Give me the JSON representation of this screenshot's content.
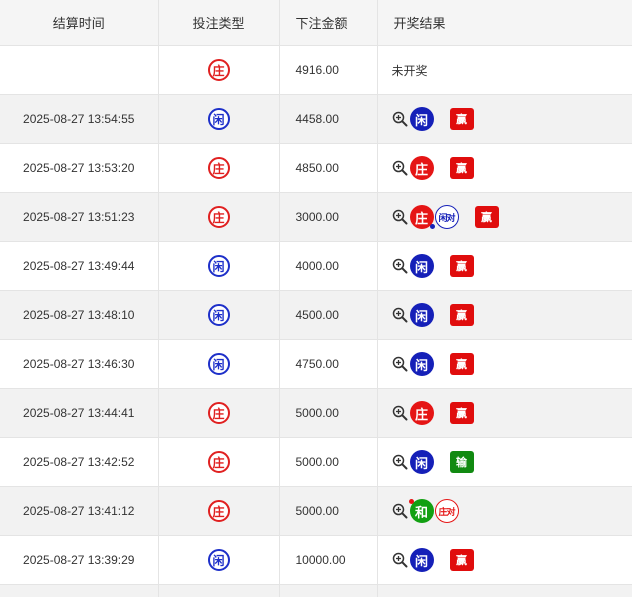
{
  "headers": {
    "settle_time": "结算时间",
    "bet_type": "投注类型",
    "bet_amount": "下注金额",
    "result": "开奖结果"
  },
  "rows": [
    {
      "time": "",
      "bet": "庄",
      "bet_side": "zhuang",
      "amount": "4916.00",
      "pending": "未开奖"
    },
    {
      "time": "2025-08-27 13:54:55",
      "bet": "闲",
      "bet_side": "xian",
      "amount": "4458.00",
      "result_ball": "闲",
      "result_side": "xian",
      "outcome": "赢",
      "outcome_kind": "win"
    },
    {
      "time": "2025-08-27 13:53:20",
      "bet": "庄",
      "bet_side": "zhuang",
      "amount": "4850.00",
      "result_ball": "庄",
      "result_side": "zhuang",
      "outcome": "赢",
      "outcome_kind": "win"
    },
    {
      "time": "2025-08-27 13:51:23",
      "bet": "庄",
      "bet_side": "zhuang",
      "amount": "3000.00",
      "result_ball": "庄",
      "result_side": "zhuang",
      "dot": "blue-br",
      "pair": "闲对",
      "pair_side": "xian",
      "outcome": "赢",
      "outcome_kind": "win"
    },
    {
      "time": "2025-08-27 13:49:44",
      "bet": "闲",
      "bet_side": "xian",
      "amount": "4000.00",
      "result_ball": "闲",
      "result_side": "xian",
      "outcome": "赢",
      "outcome_kind": "win"
    },
    {
      "time": "2025-08-27 13:48:10",
      "bet": "闲",
      "bet_side": "xian",
      "amount": "4500.00",
      "result_ball": "闲",
      "result_side": "xian",
      "outcome": "赢",
      "outcome_kind": "win"
    },
    {
      "time": "2025-08-27 13:46:30",
      "bet": "闲",
      "bet_side": "xian",
      "amount": "4750.00",
      "result_ball": "闲",
      "result_side": "xian",
      "outcome": "赢",
      "outcome_kind": "win"
    },
    {
      "time": "2025-08-27 13:44:41",
      "bet": "庄",
      "bet_side": "zhuang",
      "amount": "5000.00",
      "result_ball": "庄",
      "result_side": "zhuang",
      "outcome": "赢",
      "outcome_kind": "win"
    },
    {
      "time": "2025-08-27 13:42:52",
      "bet": "庄",
      "bet_side": "zhuang",
      "amount": "5000.00",
      "result_ball": "闲",
      "result_side": "xian",
      "outcome": "输",
      "outcome_kind": "lose"
    },
    {
      "time": "2025-08-27 13:41:12",
      "bet": "庄",
      "bet_side": "zhuang",
      "amount": "5000.00",
      "result_ball": "和",
      "result_side": "he",
      "dot": "red-tl",
      "pair": "庄对",
      "pair_side": "zhuang"
    },
    {
      "time": "2025-08-27 13:39:29",
      "bet": "闲",
      "bet_side": "xian",
      "amount": "10000.00",
      "result_ball": "闲",
      "result_side": "xian",
      "outcome": "赢",
      "outcome_kind": "win"
    }
  ],
  "icons": {
    "detail": "zoom-in-icon"
  },
  "colors": {
    "zhuang": "#e51515",
    "xian": "#1520b8",
    "he": "#12a012",
    "win": "#e00d0d",
    "lose": "#118a11"
  }
}
